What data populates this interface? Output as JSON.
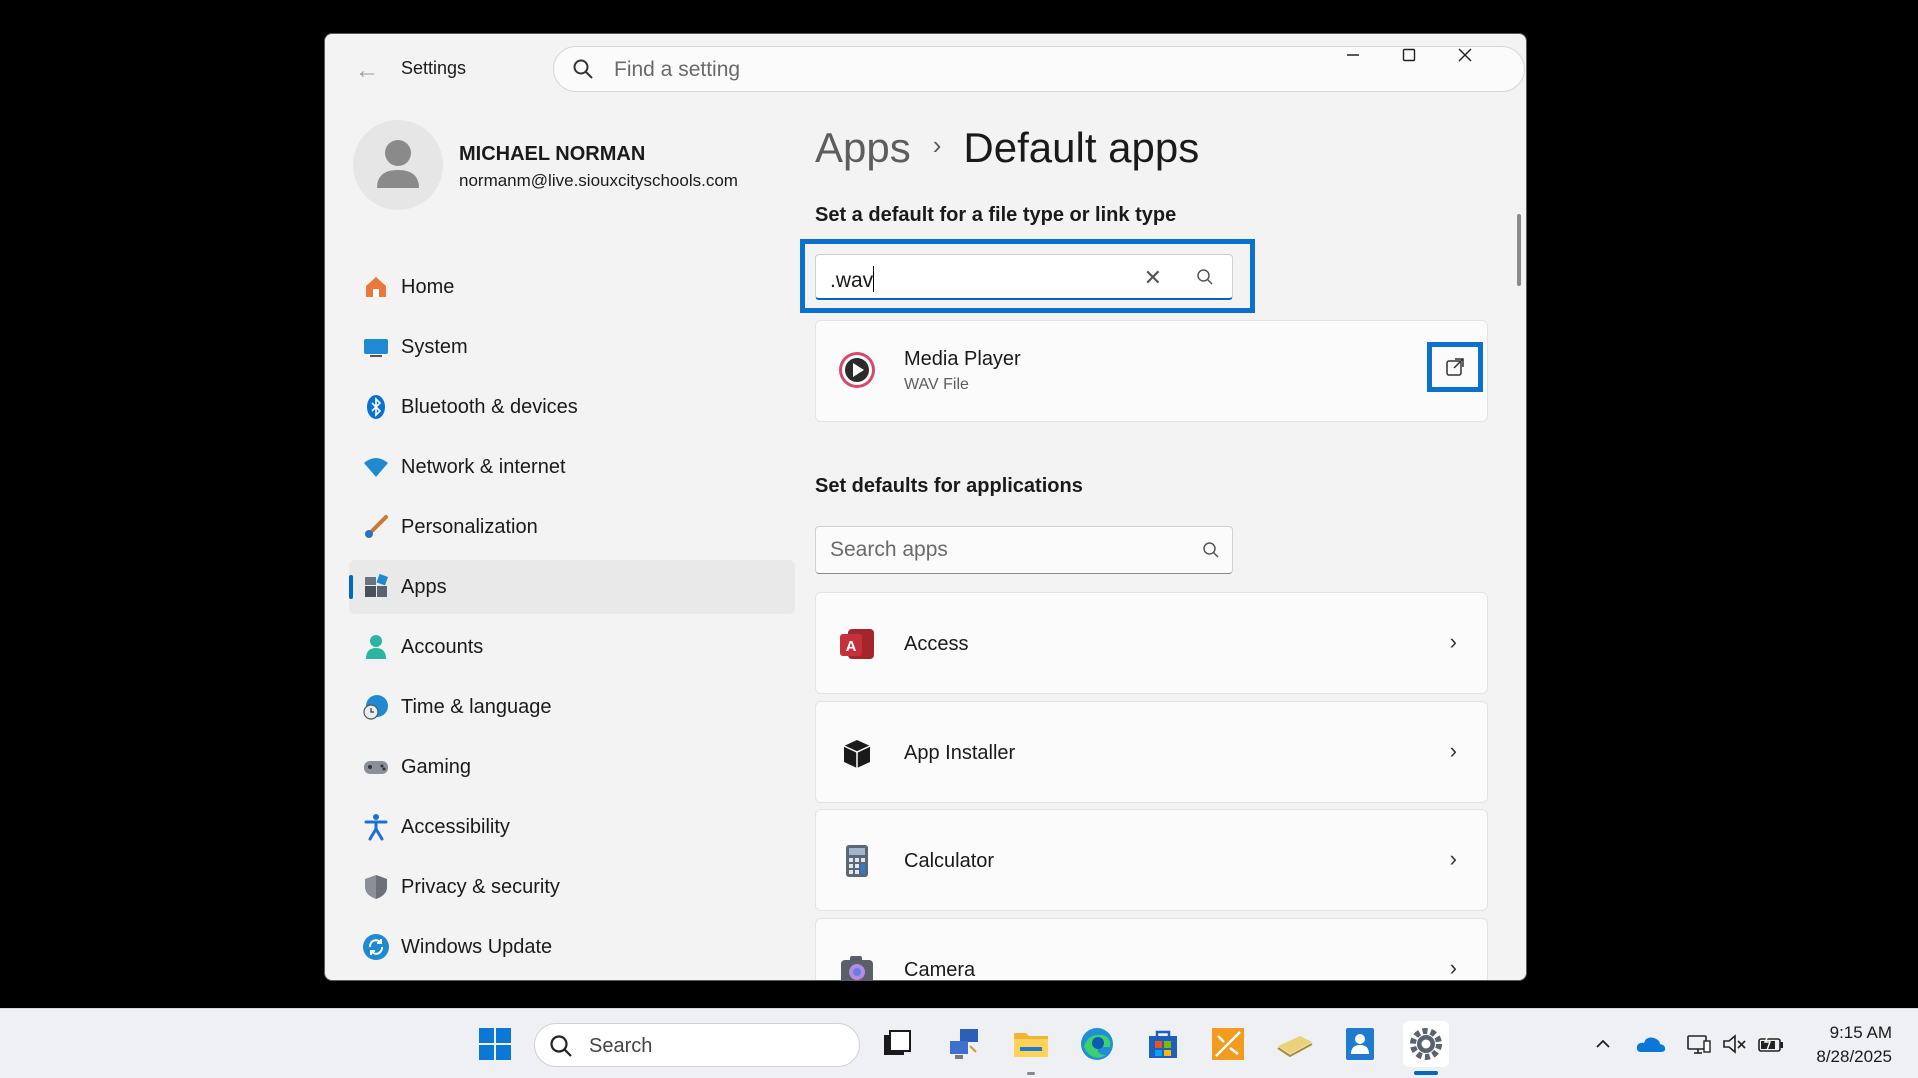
{
  "window": {
    "title": "Settings",
    "search_placeholder": "Find a setting"
  },
  "profile": {
    "name": "MICHAEL NORMAN",
    "email": "normanm@live.siouxcityschools.com"
  },
  "nav": {
    "items": [
      {
        "label": "Home",
        "icon": "home-icon"
      },
      {
        "label": "System",
        "icon": "system-icon"
      },
      {
        "label": "Bluetooth & devices",
        "icon": "bluetooth-icon"
      },
      {
        "label": "Network & internet",
        "icon": "wifi-icon"
      },
      {
        "label": "Personalization",
        "icon": "brush-icon"
      },
      {
        "label": "Apps",
        "icon": "apps-icon",
        "active": true
      },
      {
        "label": "Accounts",
        "icon": "accounts-icon"
      },
      {
        "label": "Time & language",
        "icon": "globe-clock-icon"
      },
      {
        "label": "Gaming",
        "icon": "gamepad-icon"
      },
      {
        "label": "Accessibility",
        "icon": "accessibility-icon"
      },
      {
        "label": "Privacy & security",
        "icon": "shield-icon"
      },
      {
        "label": "Windows Update",
        "icon": "update-icon"
      }
    ]
  },
  "main": {
    "breadcrumb_parent": "Apps",
    "breadcrumb_current": "Default apps",
    "filetype_heading": "Set a default for a file type or link type",
    "filetype_value": ".wav",
    "filetype_result": {
      "app": "Media Player",
      "type": "WAV File"
    },
    "apps_heading": "Set defaults for applications",
    "apps_search_placeholder": "Search apps",
    "apps": [
      {
        "name": "Access",
        "icon": "access-icon"
      },
      {
        "name": "App Installer",
        "icon": "app-installer-icon"
      },
      {
        "name": "Calculator",
        "icon": "calculator-icon"
      },
      {
        "name": "Camera",
        "icon": "camera-icon"
      }
    ]
  },
  "taskbar": {
    "search_label": "Search",
    "time": "9:15 AM",
    "date": "8/28/2025"
  },
  "colors": {
    "accent": "#0067c0",
    "highlight": "#0a72cc"
  }
}
